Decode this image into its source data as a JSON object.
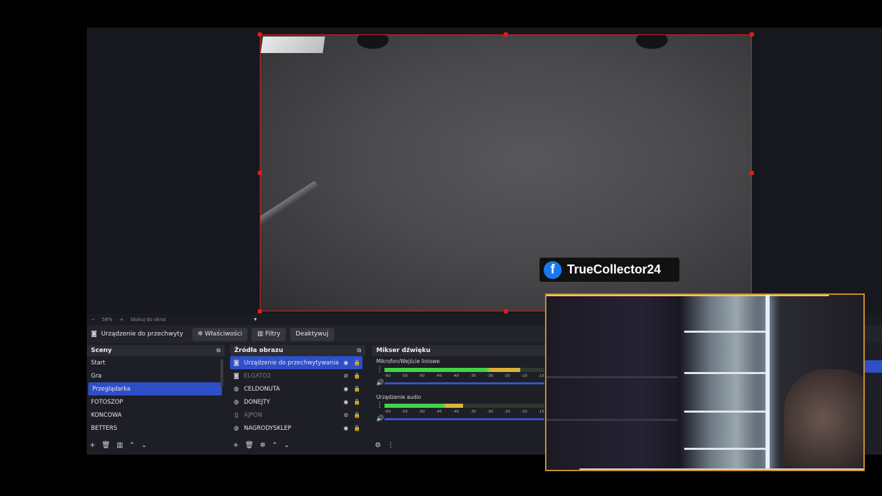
{
  "preview": {
    "zoom": "58%",
    "zoom_minus": "−",
    "zoom_plus": "+",
    "scale_label": "Skaluj do okna"
  },
  "sourcebar": {
    "selected_source": "Urządzenie do przechwyty",
    "properties": "Właściwości",
    "filters": "Filtry",
    "deactivate": "Deaktywuj"
  },
  "scenes": {
    "title": "Sceny",
    "items": [
      {
        "label": "Start",
        "selected": false
      },
      {
        "label": "Gra",
        "selected": false
      },
      {
        "label": "Przeglądarka",
        "selected": true
      },
      {
        "label": "FOTOSZOP",
        "selected": false
      },
      {
        "label": "KONCOWA",
        "selected": false
      },
      {
        "label": "BETTERS",
        "selected": false
      }
    ]
  },
  "sources": {
    "title": "Źródła obrazu",
    "items": [
      {
        "label": "Urządzenie do przechwytywania wid",
        "icon": "camera-icon",
        "visible": true,
        "selected": true
      },
      {
        "label": "ELGATO2",
        "icon": "camera-icon",
        "visible": false,
        "selected": false
      },
      {
        "label": "CELDONUTA",
        "icon": "globe-icon",
        "visible": true,
        "selected": false
      },
      {
        "label": "DONEJTY",
        "icon": "globe-icon",
        "visible": true,
        "selected": false
      },
      {
        "label": "AJPON",
        "icon": "file-icon",
        "visible": false,
        "selected": false
      },
      {
        "label": "NAGRODYSKLEP",
        "icon": "globe-icon",
        "visible": true,
        "selected": false
      }
    ]
  },
  "mixer": {
    "title": "Mikser dźwięku",
    "channels": [
      {
        "label": "Mikrofon/Wejście liniowe",
        "level": 0.85
      },
      {
        "label": "Urządzenie audio",
        "level": 0.49
      }
    ],
    "ticks": [
      "-60",
      "-55",
      "-50",
      "-45",
      "-40",
      "-35",
      "-30",
      "-25",
      "-20",
      "-15"
    ]
  },
  "overlay": {
    "facebook_name": "TrueCollector24",
    "fb_letter": "f"
  },
  "colors": {
    "accent": "#2f4fc8",
    "selection_border": "#e01c1c",
    "meter_green": "#3fd44a",
    "meter_yellow": "#d8b23a"
  }
}
